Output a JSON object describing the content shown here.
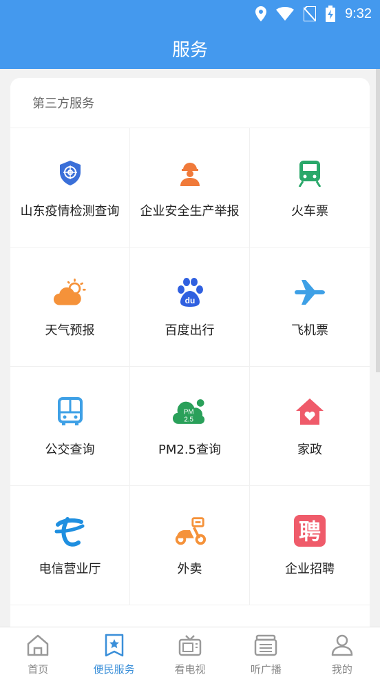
{
  "status_bar": {
    "time": "9:32"
  },
  "header": {
    "title": "服务"
  },
  "section": {
    "title": "第三方服务"
  },
  "services": [
    {
      "label": "山东疫情检测查询",
      "icon": "shield-target-icon",
      "color": "#3a6fd8"
    },
    {
      "label": "企业安全生产举报",
      "icon": "worker-helmet-icon",
      "color": "#f07a3a"
    },
    {
      "label": "火车票",
      "icon": "train-icon",
      "color": "#2aa86a"
    },
    {
      "label": "天气预报",
      "icon": "weather-sun-cloud-icon",
      "color": "#f5923a"
    },
    {
      "label": "百度出行",
      "icon": "baidu-paw-icon",
      "color": "#3060e0"
    },
    {
      "label": "飞机票",
      "icon": "airplane-icon",
      "color": "#3ea0e6"
    },
    {
      "label": "公交查询",
      "icon": "bus-icon",
      "color": "#3ea0e6"
    },
    {
      "label": "PM2.5查询",
      "icon": "pm25-cloud-icon",
      "color": "#2aa05a"
    },
    {
      "label": "家政",
      "icon": "home-heart-icon",
      "color": "#ef5b6a"
    },
    {
      "label": "电信营业厅",
      "icon": "telecom-logo-icon",
      "color": "#1f8fe0"
    },
    {
      "label": "外卖",
      "icon": "scooter-icon",
      "color": "#f5923a"
    },
    {
      "label": "企业招聘",
      "icon": "recruit-pin-icon",
      "color": "#ef5b6a",
      "glyph": "聘"
    }
  ],
  "nav": [
    {
      "label": "首页",
      "icon": "home-icon",
      "active": false
    },
    {
      "label": "便民服务",
      "icon": "bookmark-star-icon",
      "active": true
    },
    {
      "label": "看电视",
      "icon": "tv-icon",
      "active": false
    },
    {
      "label": "听广播",
      "icon": "radio-icon",
      "active": false
    },
    {
      "label": "我的",
      "icon": "user-icon",
      "active": false
    }
  ]
}
